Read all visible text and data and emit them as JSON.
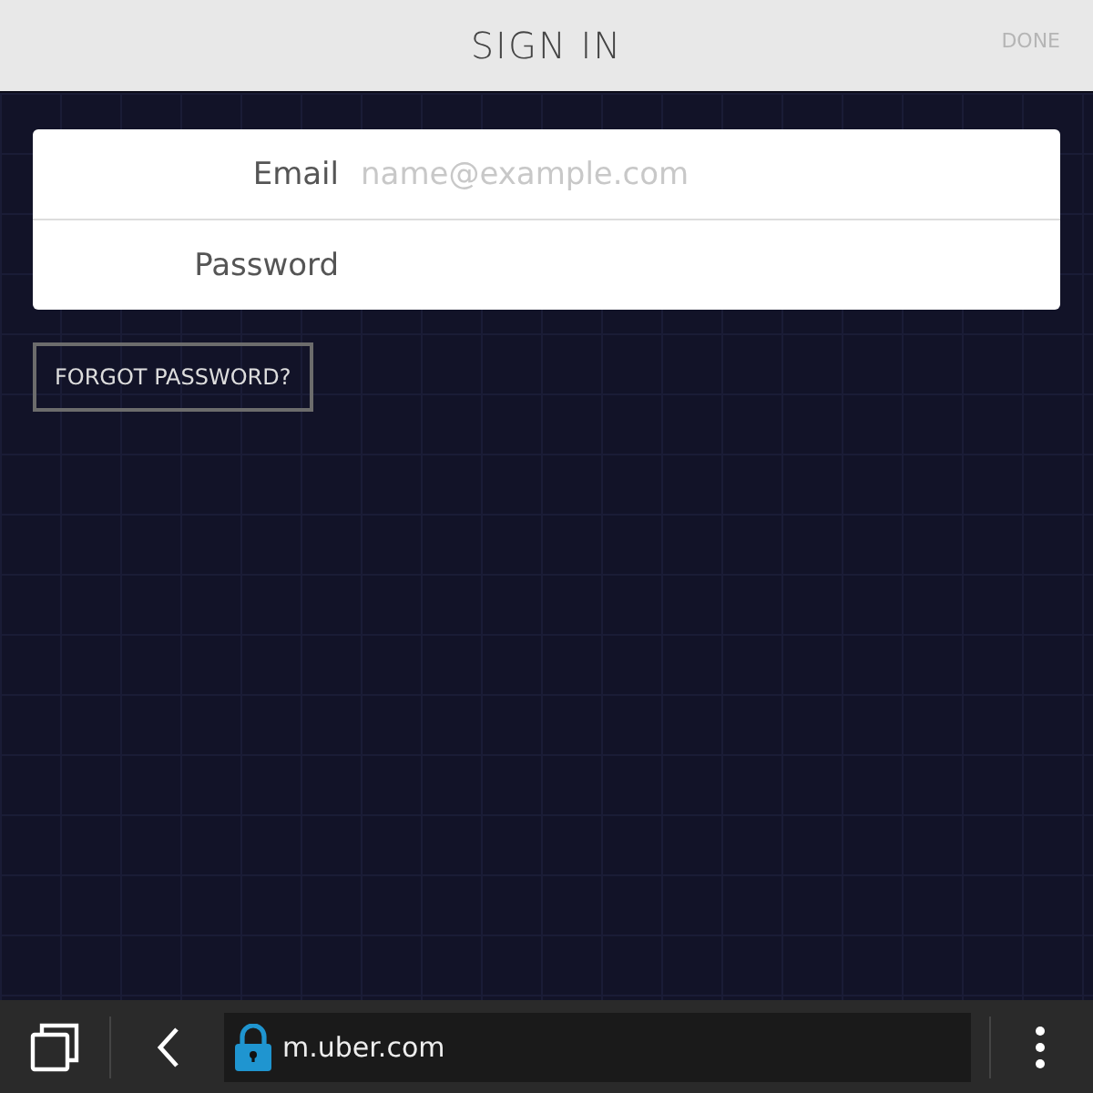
{
  "header": {
    "title": "SIGN IN",
    "done_button": "DONE"
  },
  "form": {
    "fields": [
      {
        "label": "Email",
        "placeholder": "name@example.com"
      },
      {
        "label": "Password"
      }
    ]
  },
  "forgot_button": "FORGOT PASSWORD?",
  "browser_bar": {
    "url": "m.uber.com",
    "secure": true
  }
}
